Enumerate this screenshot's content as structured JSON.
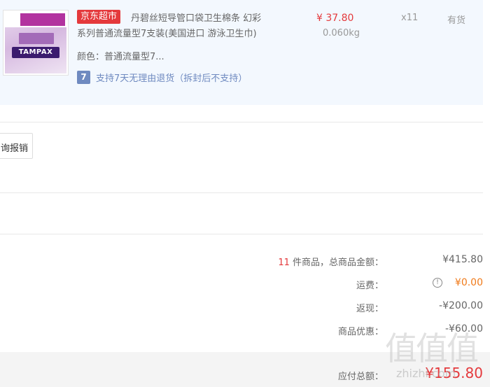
{
  "product": {
    "store_badge": "京东超市",
    "title_line1": "丹碧丝短导管口袋卫生棉条 幻彩",
    "title_line2": "系列普通流量型7支装(美国进口 游泳卫生巾)",
    "color": "颜色：普通流量型7...",
    "return_icon": "7",
    "return_policy": "支持7天无理由退货（拆封后不支持）",
    "price": "¥ 37.80",
    "weight": "0.060kg",
    "quantity": "x11",
    "stock": "有货",
    "image_brand": "TAMPAX"
  },
  "actions": {
    "report_label": "询报销"
  },
  "summary": {
    "count": "11",
    "count_suffix": " 件商品，总商品金额：",
    "goods_total": "¥415.80",
    "shipping_label": "运费：",
    "shipping_value": "¥0.00",
    "shipping_info_icon": "!",
    "cashback_label": "返现：",
    "cashback_value": "-¥200.00",
    "discount_label": "商品优惠：",
    "discount_value": "-¥60.00",
    "payable_label": "应付总额：",
    "payable_value": "¥155.80"
  },
  "watermark": {
    "glyphs": "值值值",
    "url": "zhizhi.com"
  },
  "colors": {
    "accent_red": "#e4393c",
    "panel_bg": "#f3f8fe",
    "return_blue": "#6f8ac0",
    "free_orange": "#f07a1a"
  },
  "icons": {
    "return_policy": "seven-day-return-icon",
    "shipping_info": "info-circle-icon"
  }
}
